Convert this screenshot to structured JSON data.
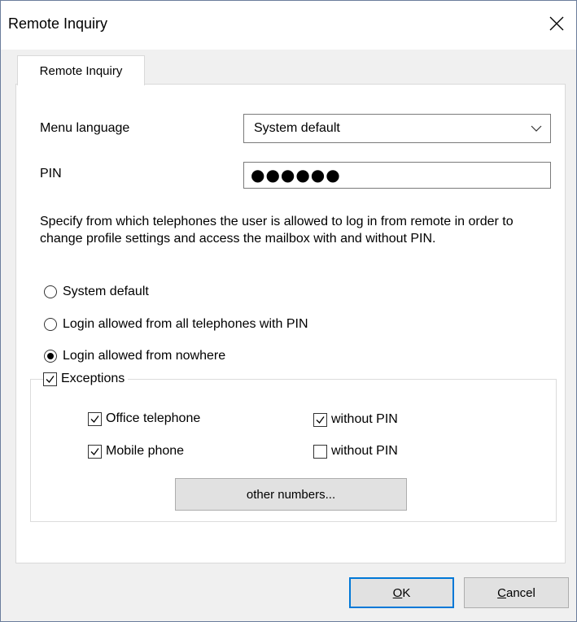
{
  "window": {
    "title": "Remote Inquiry",
    "close_icon": "close-icon"
  },
  "tabs": [
    {
      "label": "Remote Inquiry",
      "selected": true
    }
  ],
  "menu_language": {
    "label": "Menu language",
    "value": "System default"
  },
  "pin": {
    "label": "PIN",
    "masked_value": "●●●●●●"
  },
  "description": "Specify from which telephones the user is allowed to log in from remote in order to change profile settings and access the mailbox with and without PIN.",
  "login_options": [
    {
      "label": "System default",
      "selected": false
    },
    {
      "label": "Login allowed from all telephones with PIN",
      "selected": false
    },
    {
      "label": "Login allowed from nowhere",
      "selected": true
    }
  ],
  "exceptions": {
    "label": "Exceptions",
    "checked": true,
    "office": {
      "label": "Office telephone",
      "checked": true,
      "without_pin_label": "without PIN",
      "without_pin_checked": true
    },
    "mobile": {
      "label": "Mobile phone",
      "checked": true,
      "without_pin_label": "without PIN",
      "without_pin_checked": false
    },
    "other_numbers_label": "other numbers..."
  },
  "buttons": {
    "ok_label": "OK",
    "ok_mnemonic": "O",
    "ok_rest": "K",
    "cancel_mnemonic": "C",
    "cancel_rest": "ancel"
  },
  "colors": {
    "accent": "#0078d7"
  }
}
